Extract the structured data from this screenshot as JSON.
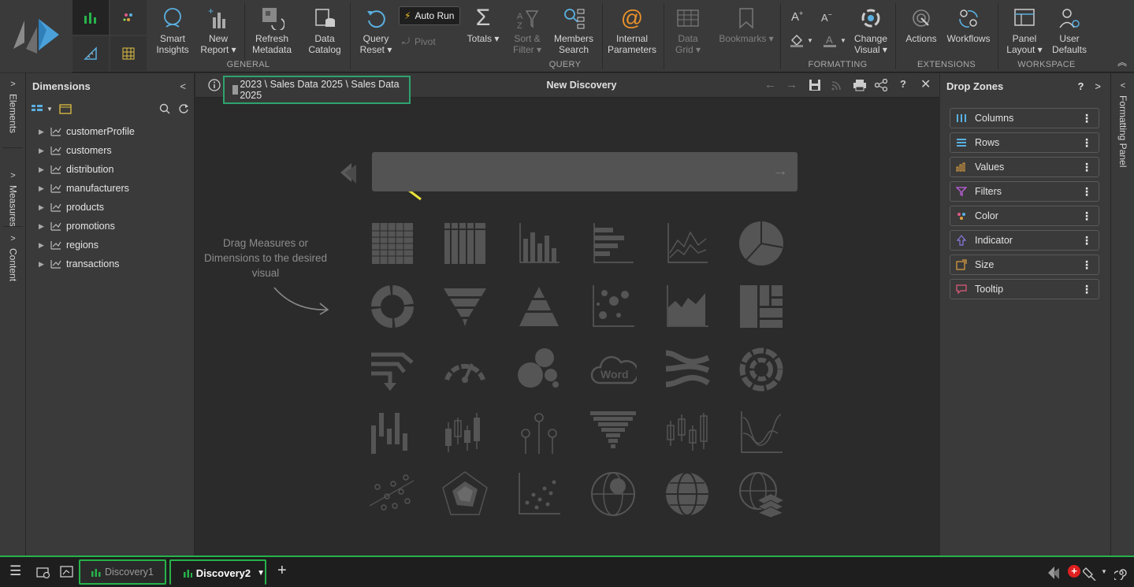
{
  "ribbon": {
    "buttons": {
      "smart_insights": "Smart\nInsights",
      "new_report": "New\nReport ▾",
      "refresh_metadata": "Refresh\nMetadata",
      "data_catalog": "Data\nCatalog",
      "query_reset": "Query\nReset ▾",
      "auto_run": "Auto Run",
      "pivot": "Pivot",
      "totals": "Totals ▾",
      "sort_filter": "Sort &\nFilter ▾",
      "members_search": "Members\nSearch",
      "internal_parameters": "Internal\nParameters",
      "data_grid": "Data\nGrid ▾",
      "bookmarks": "Bookmarks ▾",
      "change_visual": "Change\nVisual ▾",
      "actions": "Actions",
      "workflows": "Workflows",
      "panel_layout": "Panel\nLayout ▾",
      "user_defaults": "User\nDefaults"
    },
    "groups": {
      "general": "GENERAL",
      "query": "QUERY",
      "formatting": "FORMATTING",
      "extensions": "EXTENSIONS",
      "workspace": "WORKSPACE"
    }
  },
  "rails": {
    "left": [
      "Elements",
      "Measures",
      "Content"
    ],
    "right": "Formatting Panel"
  },
  "dimensions": {
    "title": "Dimensions",
    "items": [
      "customerProfile",
      "customers",
      "distribution",
      "manufacturers",
      "products",
      "promotions",
      "regions",
      "transactions"
    ]
  },
  "center": {
    "breadcrumb": "2023 \\ Sales Data 2025 \\ Sales Data 2025",
    "title": "New Discovery",
    "drag_hint": "Drag Measures or Dimensions to the desired visual",
    "word_label": "Word"
  },
  "drop_zones": {
    "title": "Drop Zones",
    "help": "?",
    "items": [
      "Columns",
      "Rows",
      "Values",
      "Filters",
      "Color",
      "Indicator",
      "Size",
      "Tooltip"
    ]
  },
  "bottom": {
    "tabs": [
      "Discovery1",
      "Discovery2"
    ]
  },
  "colors": {
    "accent_green": "#27b34a",
    "highlight_border": "#2ea36f",
    "arrow_yellow": "#e8e23a"
  }
}
